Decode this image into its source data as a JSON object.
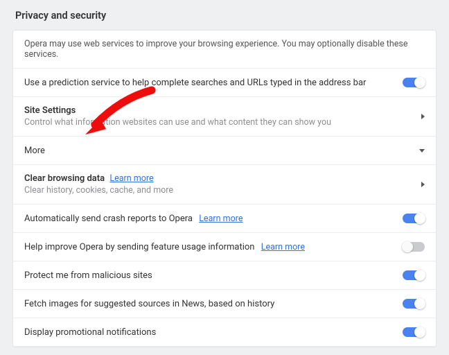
{
  "section": {
    "title": "Privacy and security"
  },
  "intro": "Opera may use web services to improve your browsing experience. You may optionally disable these services.",
  "rows": {
    "prediction": {
      "label": "Use a prediction service to help complete searches and URLs typed in the address bar",
      "on": true
    },
    "siteSettings": {
      "title": "Site Settings",
      "subtitle": "Control what information websites can use and what content they can show you"
    },
    "more": {
      "label": "More"
    },
    "clearData": {
      "title": "Clear browsing data",
      "learn": "Learn more",
      "subtitle": "Clear history, cookies, cache, and more"
    },
    "crash": {
      "label": "Automatically send crash reports to Opera",
      "learn": "Learn more",
      "on": true
    },
    "improve": {
      "label": "Help improve Opera by sending feature usage information",
      "learn": "Learn more",
      "on": false
    },
    "protect": {
      "label": "Protect me from malicious sites",
      "on": true
    },
    "fetch": {
      "label": "Fetch images for suggested sources in News, based on history",
      "on": true
    },
    "promo": {
      "label": "Display promotional notifications",
      "on": true
    }
  }
}
